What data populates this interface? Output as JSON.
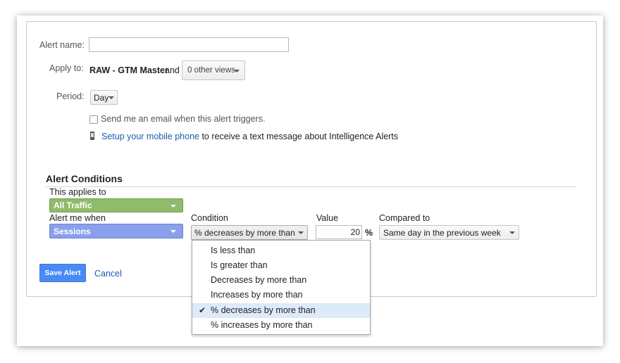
{
  "form": {
    "alert_name_label": "Alert name:",
    "alert_name_value": "",
    "apply_to_label": "Apply to:",
    "apply_to_view": "RAW - GTM Master",
    "apply_to_and": "and",
    "other_views": "0 other views",
    "period_label": "Period:",
    "period_value": "Day",
    "email_checkbox_label": "Send me an email when this alert triggers.",
    "email_checked": false,
    "mobile_link": "Setup your mobile phone",
    "mobile_text": " to receive a text message about Intelligence Alerts"
  },
  "conditions": {
    "title": "Alert Conditions",
    "applies_to_label": "This applies to",
    "applies_to_value": "All Traffic",
    "alert_when_label": "Alert me when",
    "alert_when_value": "Sessions",
    "condition_label": "Condition",
    "condition_value": "% decreases by more than",
    "value_label": "Value",
    "value": "20",
    "value_unit": "%",
    "compared_label": "Compared to",
    "compared_value": "Same day in the previous week"
  },
  "condition_menu": {
    "items": [
      {
        "label": "Is less than",
        "selected": false
      },
      {
        "label": "Is greater than",
        "selected": false
      },
      {
        "label": "Decreases by more than",
        "selected": false
      },
      {
        "label": "Increases by more than",
        "selected": false
      },
      {
        "label": "% decreases by more than",
        "selected": true
      },
      {
        "label": "% increases by more than",
        "selected": false
      }
    ],
    "check_glyph": "✔"
  },
  "actions": {
    "save_label": "Save Alert",
    "cancel_label": "Cancel"
  },
  "colors": {
    "accent_blue": "#4a8af4",
    "link_blue": "#1a5dae",
    "segment_green": "#8fbb6a",
    "metric_blue": "#8aa0ea",
    "menu_selected": "#dceaf9"
  }
}
